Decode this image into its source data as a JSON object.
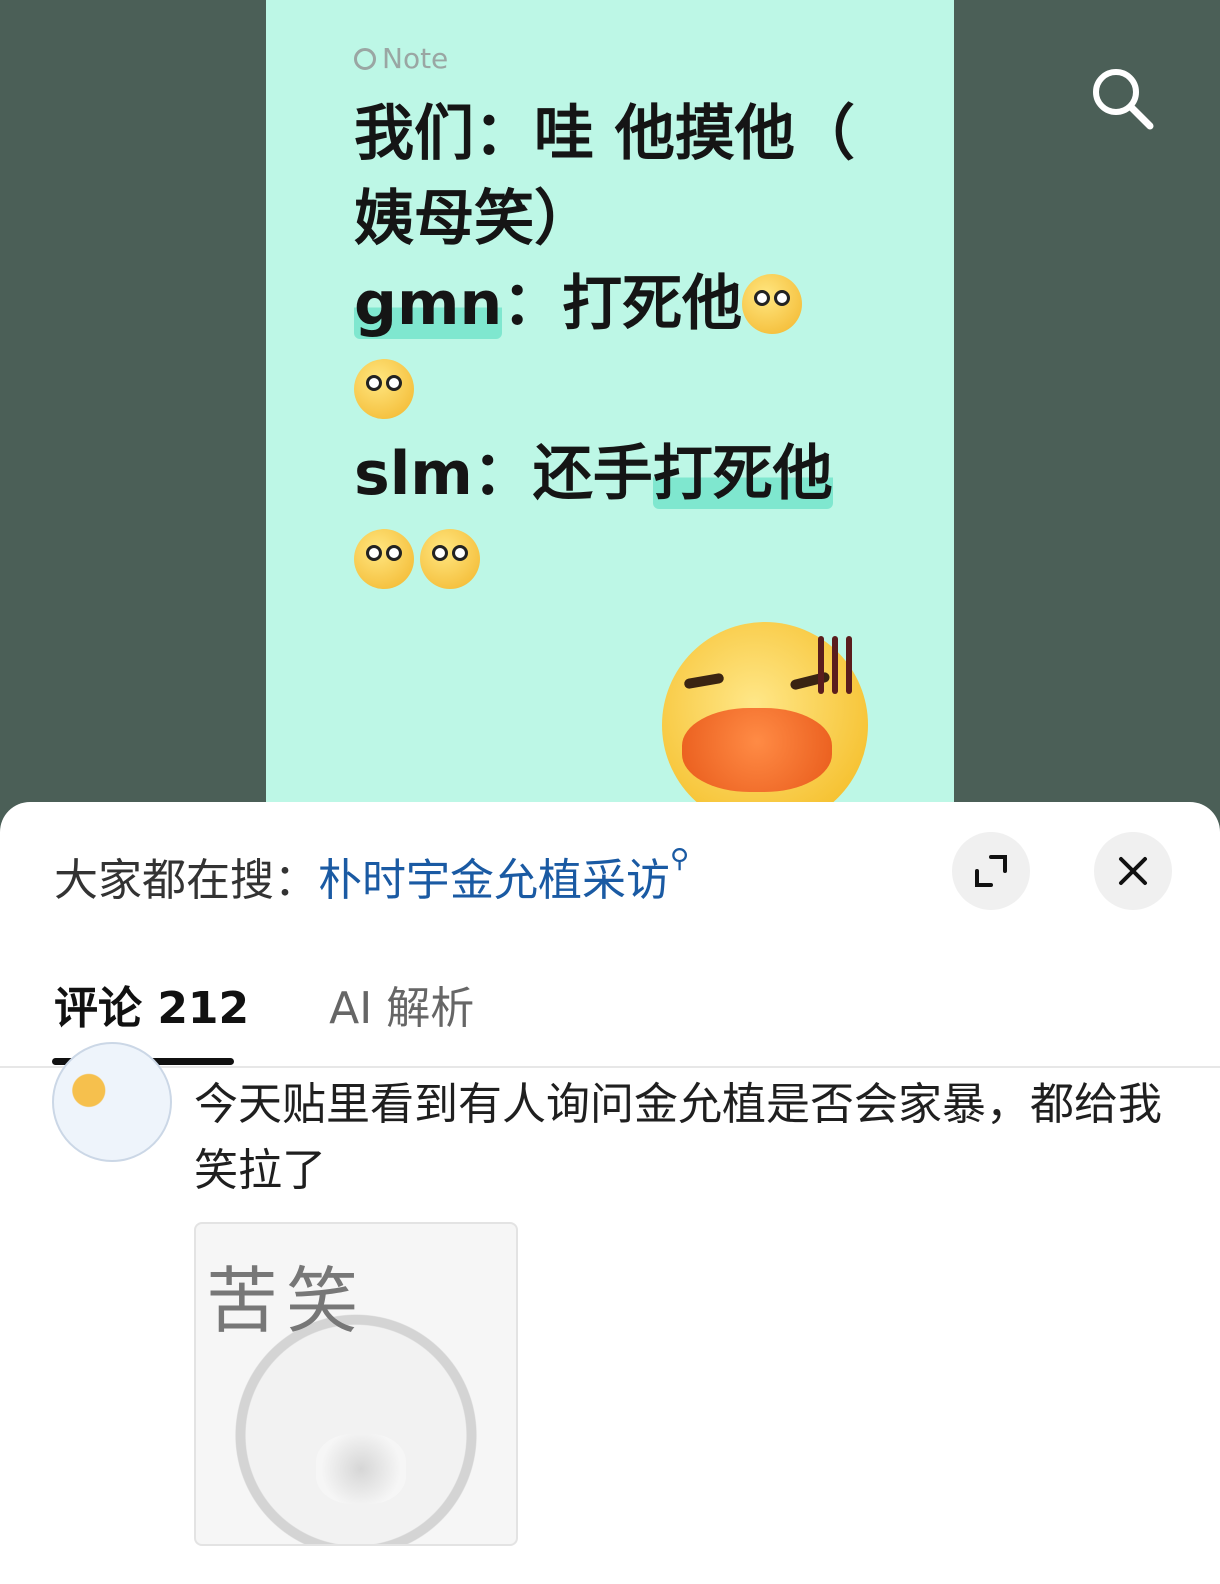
{
  "note": {
    "label": "Note",
    "line1": "我们：哇 他摸他（",
    "line2": "姨母笑）",
    "line3_name": "gmn",
    "line3_rest": "：打死他",
    "line5_name": "slm：还手",
    "line5_hl": "打死他"
  },
  "search": {
    "prefix": "大家都在搜：",
    "keyword": "朴时宇金允植采访",
    "keyword_icon": "search-icon-small"
  },
  "tabs": [
    {
      "label": "评论 212",
      "active": true
    },
    {
      "label": "AI 解析",
      "active": false
    }
  ],
  "comment": {
    "text": "今天贴里看到有人询问金允植是否会家暴，都给我笑拉了",
    "image_text": "苦笑"
  },
  "icons": {
    "top_search": "search-icon",
    "expand": "expand-icon",
    "close": "close-icon"
  },
  "colors": {
    "background": "#4b5f57",
    "note": "#bdf7e6",
    "highlight": "#7fe7cf",
    "link": "#1a5aa3"
  }
}
